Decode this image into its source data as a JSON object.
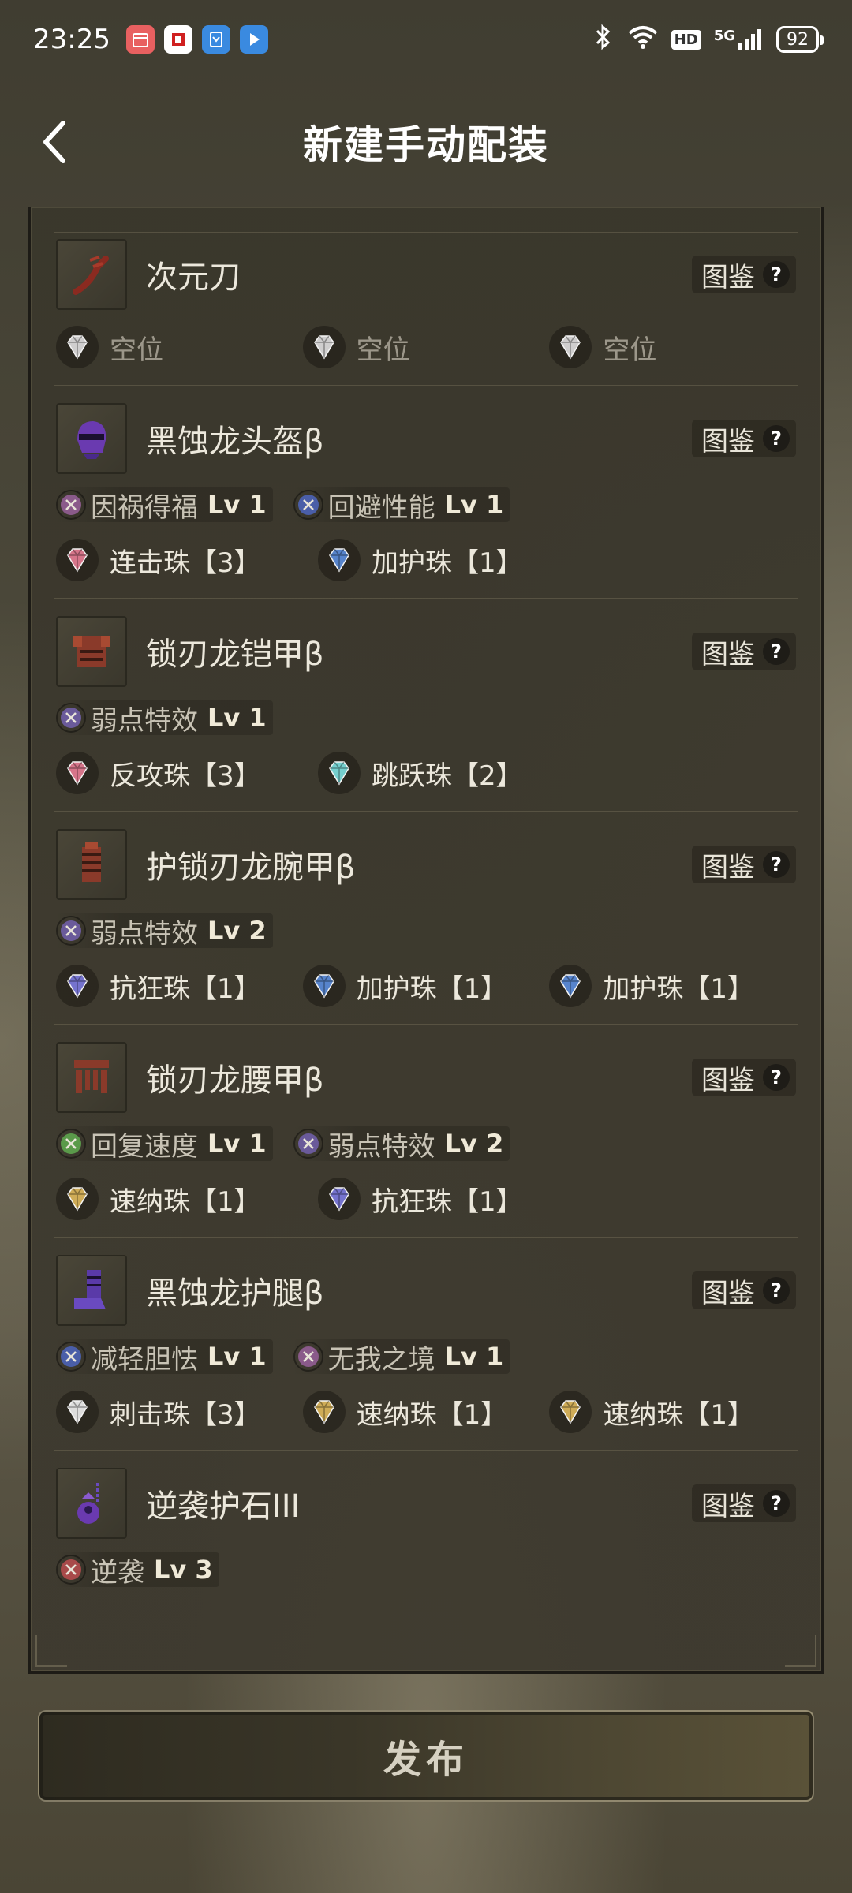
{
  "status_bar": {
    "time": "23:25",
    "hd": "HD",
    "network": "5G",
    "battery": "92"
  },
  "header": {
    "title": "新建手动配装"
  },
  "dex_label": "图鉴",
  "help_glyph": "?",
  "equipment": [
    {
      "name": "次元刀",
      "icon": "long-sword-icon",
      "skills": [],
      "decorations": [
        {
          "label": "空位",
          "color": "#d8d8d8",
          "empty": true
        },
        {
          "label": "空位",
          "color": "#d8d8d8",
          "empty": true
        },
        {
          "label": "空位",
          "color": "#d8d8d8",
          "empty": true
        }
      ]
    },
    {
      "name": "黑蚀龙头盔β",
      "icon": "helmet-icon",
      "skills": [
        {
          "name": "因祸得福",
          "level": "Lv 1",
          "color": "#8a5a8a"
        },
        {
          "name": "回避性能",
          "level": "Lv 1",
          "color": "#4a5ea8"
        }
      ],
      "decorations": [
        {
          "label": "连击珠【3】",
          "color": "#e07a90",
          "empty": false
        },
        {
          "label": "加护珠【1】",
          "color": "#5a8ad6",
          "empty": false
        }
      ]
    },
    {
      "name": "锁刃龙铠甲β",
      "icon": "chest-armor-icon",
      "skills": [
        {
          "name": "弱点特效",
          "level": "Lv 1",
          "color": "#6a5a9a"
        }
      ],
      "decorations": [
        {
          "label": "反攻珠【3】",
          "color": "#e07a90",
          "empty": false
        },
        {
          "label": "跳跃珠【2】",
          "color": "#7ad8d8",
          "empty": false
        }
      ]
    },
    {
      "name": "护锁刃龙腕甲β",
      "icon": "gauntlet-icon",
      "skills": [
        {
          "name": "弱点特效",
          "level": "Lv 2",
          "color": "#6a5a9a"
        }
      ],
      "decorations": [
        {
          "label": "抗狂珠【1】",
          "color": "#7a78d8",
          "empty": false
        },
        {
          "label": "加护珠【1】",
          "color": "#5a8ad6",
          "empty": false
        },
        {
          "label": "加护珠【1】",
          "color": "#5a8ad6",
          "empty": false
        }
      ]
    },
    {
      "name": "锁刃龙腰甲β",
      "icon": "waist-armor-icon",
      "skills": [
        {
          "name": "回复速度",
          "level": "Lv 1",
          "color": "#5a9a4a"
        },
        {
          "name": "弱点特效",
          "level": "Lv 2",
          "color": "#6a5a9a"
        }
      ],
      "decorations": [
        {
          "label": "速纳珠【1】",
          "color": "#d8b45a",
          "empty": false
        },
        {
          "label": "抗狂珠【1】",
          "color": "#7a78d8",
          "empty": false
        }
      ]
    },
    {
      "name": "黑蚀龙护腿β",
      "icon": "greaves-icon",
      "skills": [
        {
          "name": "减轻胆怯",
          "level": "Lv 1",
          "color": "#4a5ea8"
        },
        {
          "name": "无我之境",
          "level": "Lv 1",
          "color": "#8a5a8a"
        }
      ],
      "decorations": [
        {
          "label": "刺击珠【3】",
          "color": "#e8e8e8",
          "empty": false
        },
        {
          "label": "速纳珠【1】",
          "color": "#d8b45a",
          "empty": false
        },
        {
          "label": "速纳珠【1】",
          "color": "#d8b45a",
          "empty": false
        }
      ]
    },
    {
      "name": "逆袭护石III",
      "icon": "charm-icon",
      "skills": [
        {
          "name": "逆袭",
          "level": "Lv 3",
          "color": "#a84a4a"
        }
      ],
      "decorations": []
    }
  ],
  "publish_label": "发布"
}
